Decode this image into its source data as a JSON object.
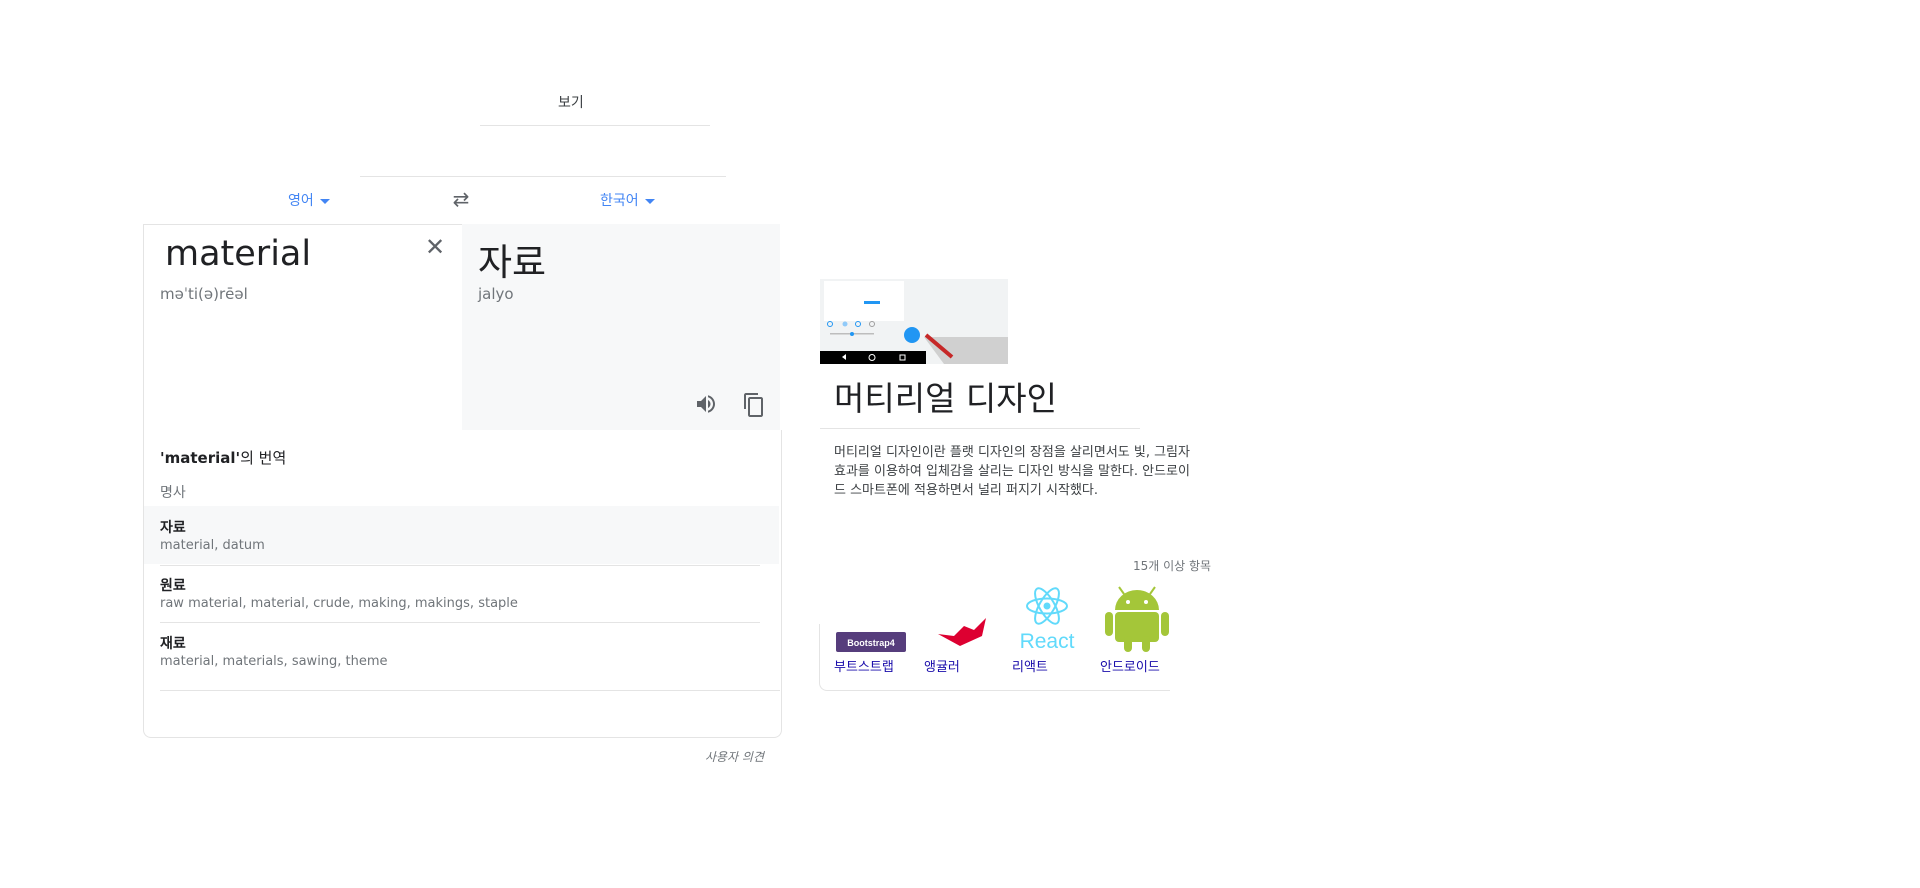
{
  "translate": {
    "top_label": "보기",
    "source_lang": "영어",
    "target_lang": "한국어",
    "source_word": "material",
    "source_pronunciation": "məˈti(ə)rēəl",
    "target_word": "자료",
    "target_romanization": "jalyo",
    "dictionary_heading_word": "'material'",
    "dictionary_heading_suffix": "의 번역",
    "part_of_speech": "명사",
    "entries": [
      {
        "word": "자료",
        "synonyms": "material, datum"
      },
      {
        "word": "원료",
        "synonyms": "raw material, material, crude, making, makings, staple"
      },
      {
        "word": "재료",
        "synonyms": "material, materials, sawing, theme"
      }
    ],
    "feedback": "사용자 의견"
  },
  "knowledge": {
    "title": "머티리얼 디자인",
    "description": "머티리얼 디자인이란 플랫 디자인의 장점을 살리면서도 빛, 그림자 효과를 이용하여 입체감을 살리는 디자인 방식을 말한다. 안드로이드 스마트폰에 적용하면서 널리 퍼지기 시작했다.",
    "more_link": "15개 이상 항목",
    "related": [
      {
        "label": "부트스트랩",
        "logo_text": "Bootstrap4",
        "color": "#563d7c"
      },
      {
        "label": "앵귤러",
        "color": "#dd0031"
      },
      {
        "label": "리액트",
        "logo_text": "React",
        "color": "#61dafb"
      },
      {
        "label": "안드로이드",
        "color": "#a4c639"
      }
    ]
  }
}
